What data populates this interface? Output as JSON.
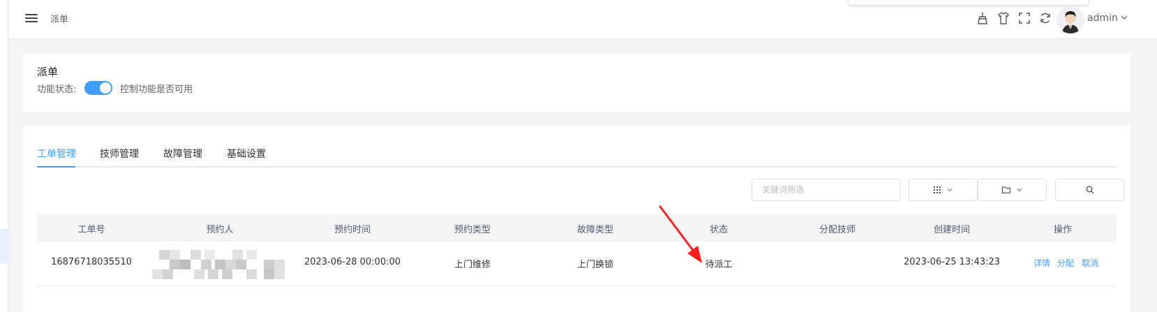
{
  "header": {
    "breadcrumb": "派单",
    "icons": [
      "brush-icon",
      "shirt-icon",
      "fullscreen-icon",
      "refresh-icon"
    ],
    "username": "admin"
  },
  "feature": {
    "title": "派单",
    "status_label": "功能状态:",
    "toggle_on": true,
    "toggle_hint": "控制功能是否可用"
  },
  "tabs": [
    "工单管理",
    "技师管理",
    "故障管理",
    "基础设置"
  ],
  "active_tab": "工单管理",
  "filter": {
    "keyword_placeholder": "关键词筛选"
  },
  "table": {
    "columns": [
      "工单号",
      "预约人",
      "预约时间",
      "预约类型",
      "故障类型",
      "状态",
      "分配技师",
      "创建时间",
      "操作"
    ],
    "rows": [
      {
        "order_no": "16876718035510",
        "booker": "",
        "booking_time": "2023-06-28 00:00:00",
        "booking_type": "上门维修",
        "fault_type": "上门换锁",
        "status": "待派工",
        "technician": "",
        "created_at": "2023-06-25 13:43:23",
        "actions": [
          "详情",
          "分配",
          "取消"
        ]
      }
    ]
  },
  "colors": {
    "accent": "#409eff",
    "arrow": "#ff1f1f"
  }
}
